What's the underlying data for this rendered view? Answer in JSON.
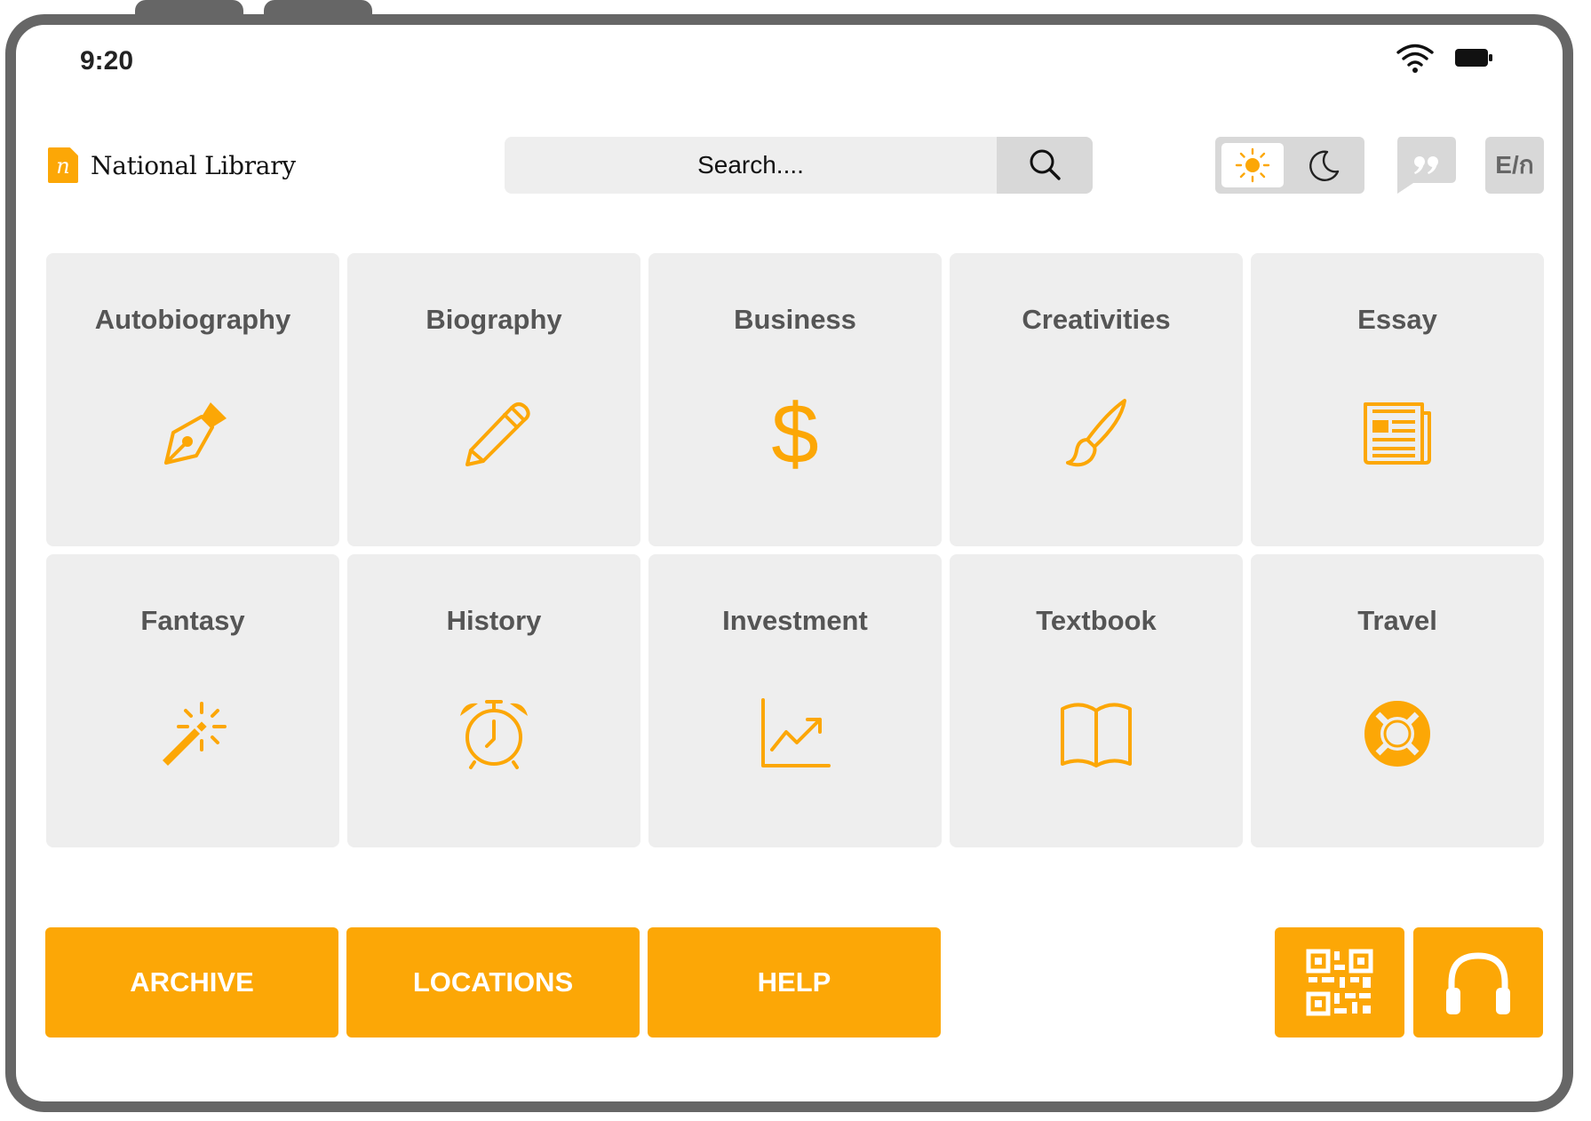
{
  "status": {
    "time": "9:20"
  },
  "header": {
    "logo_letter": "n",
    "title": "National Library",
    "search_placeholder": "Search....",
    "lang_label": "E/ก"
  },
  "categories": [
    {
      "label": "Autobiography",
      "icon": "fountain-pen-icon"
    },
    {
      "label": "Biography",
      "icon": "pencil-icon"
    },
    {
      "label": "Business",
      "icon": "dollar-icon"
    },
    {
      "label": "Creativities",
      "icon": "paintbrush-icon"
    },
    {
      "label": "Essay",
      "icon": "newspaper-icon"
    },
    {
      "label": "Fantasy",
      "icon": "magic-wand-icon"
    },
    {
      "label": "History",
      "icon": "alarm-clock-icon"
    },
    {
      "label": "Investment",
      "icon": "trend-chart-icon"
    },
    {
      "label": "Textbook",
      "icon": "open-book-icon"
    },
    {
      "label": "Travel",
      "icon": "lifebuoy-icon"
    }
  ],
  "actions": {
    "archive": "ARCHIVE",
    "locations": "LOCATIONS",
    "help": "HELP"
  },
  "colors": {
    "accent": "#fca706",
    "tile_bg": "#eeeeee",
    "frame": "#666666",
    "label": "#555555"
  }
}
